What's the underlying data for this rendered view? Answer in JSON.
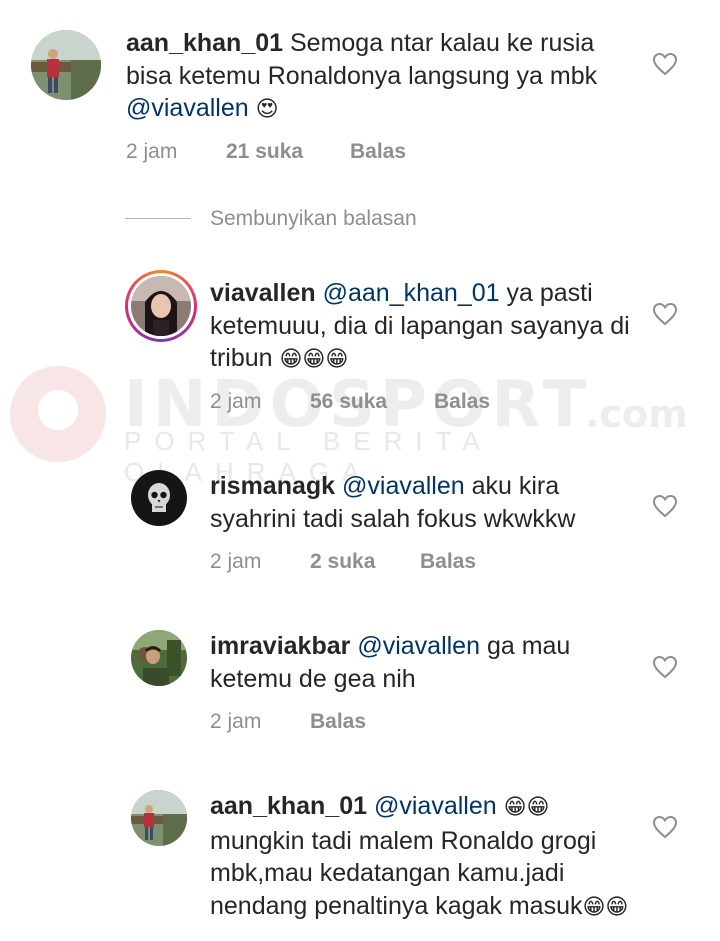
{
  "watermark": {
    "title": "INDOSPORT",
    "suffix": ".com",
    "subtitle": "PORTAL BERITA OLAHRAGA"
  },
  "comments": [
    {
      "username": "aan_khan_01",
      "text_before": "Semoga ntar kalau ke rusia bisa ketemu Ronaldonya langsung ya mbk",
      "mention": "@viavallen",
      "text_after": "",
      "emoji": "😍",
      "time": "2 jam",
      "likes": "21 suka",
      "reply": "Balas"
    },
    {
      "username": "viavallen",
      "mention": "@aan_khan_01",
      "text_after": "ya pasti ketemuuu, dia di lapangan sayanya di tribun",
      "emoji": "😁😁😁",
      "time": "2 jam",
      "likes": "56 suka",
      "reply": "Balas"
    },
    {
      "username": "rismanagk",
      "mention": "@viavallen",
      "text_after": "aku kira syahrini tadi salah fokus wkwkkw",
      "time": "2 jam",
      "likes": "2 suka",
      "reply": "Balas"
    },
    {
      "username": "imraviakbar",
      "mention": "@viavallen",
      "text_after": "ga mau ketemu de gea nih",
      "time": "2 jam",
      "reply": "Balas"
    },
    {
      "username": "aan_khan_01",
      "mention": "@viavallen",
      "emoji": "😁😁",
      "text_after": "mungkin tadi malem Ronaldo grogi mbk,mau kedatangan kamu.jadi nendang penaltinya kagak masuk",
      "emoji_end": "😁😁"
    }
  ],
  "hide_replies": "Sembunyikan balasan",
  "icons": {
    "like": "heart-icon"
  },
  "colors": {
    "mention": "#003569",
    "meta": "#8e8e8e",
    "text": "#262626"
  }
}
